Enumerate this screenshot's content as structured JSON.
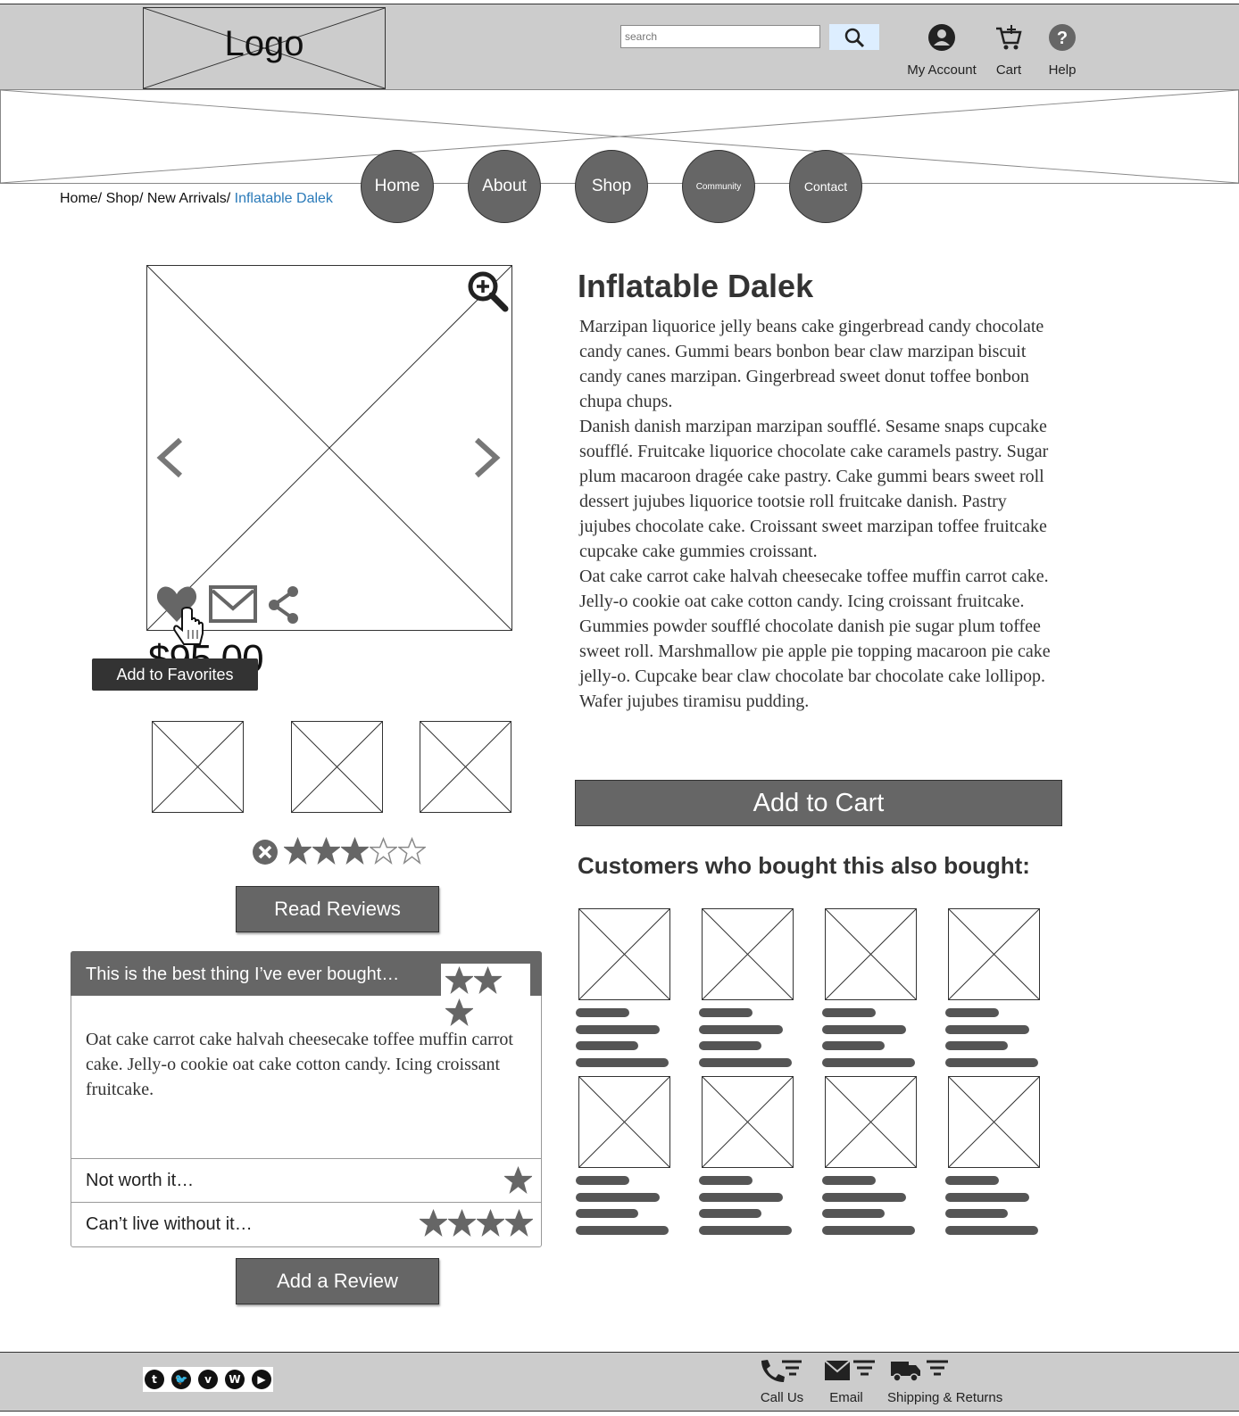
{
  "header": {
    "logo": "Logo",
    "search_placeholder": "search",
    "my_account": "My Account",
    "cart": "Cart",
    "help": "Help"
  },
  "nav": {
    "home": "Home",
    "about": "About",
    "shop": "Shop",
    "community": "Community",
    "contact": "Contact"
  },
  "breadcrumb": {
    "path": "Home/ Shop/ New Arrivals/ ",
    "current": "Inflatable Dalek"
  },
  "product": {
    "title": "Inflatable Dalek",
    "price": "$95.00",
    "tooltip": "Add to Favorites",
    "description": [
      "Marzipan liquorice jelly beans cake gingerbread candy chocolate candy canes. Gummi bears bonbon bear claw marzipan biscuit candy canes marzipan. Gingerbread sweet donut toffee bonbon chupa chups.",
      "Danish danish marzipan marzipan soufflé. Sesame snaps cupcake soufflé. Fruitcake liquorice chocolate cake caramels pastry. Sugar plum macaroon dragée cake pastry. Cake gummi bears sweet roll dessert jujubes liquorice tootsie roll fruitcake danish. Pastry jujubes chocolate cake. Croissant sweet marzipan toffee fruitcake cupcake cake gummies croissant.",
      "Oat cake carrot cake halvah cheesecake toffee muffin carrot cake. Jelly-o cookie oat cake cotton candy. Icing croissant fruitcake.",
      "Gummies powder soufflé chocolate danish pie sugar plum toffee sweet roll. Marshmallow pie apple pie topping macaroon pie cake jelly-o. Cupcake bear claw chocolate bar chocolate cake lollipop. Wafer jujubes tiramisu pudding."
    ],
    "add_to_cart": "Add to Cart",
    "rating": 3,
    "rating_max": 5
  },
  "reviews": {
    "read_reviews": "Read Reviews",
    "add_review": "Add a Review",
    "items": [
      {
        "title": "This is the best thing I’ve ever bought…",
        "stars": 3,
        "body": "Oat cake carrot cake halvah cheesecake toffee muffin carrot cake. Jelly-o cookie oat cake cotton candy. Icing croissant fruitcake."
      },
      {
        "title": "Not worth it…",
        "stars": 1
      },
      {
        "title": "Can’t live without it…",
        "stars": 4
      }
    ]
  },
  "also_bought": {
    "heading": "Customers who bought this also bought:"
  },
  "footer": {
    "call_us": "Call Us",
    "email": "Email",
    "shipping": "Shipping & Returns",
    "social": [
      "tumblr-icon",
      "twitter-icon",
      "vimeo-icon",
      "wordpress-icon",
      "youtube-icon"
    ]
  },
  "colors": {
    "header_bg": "#cccccc",
    "button_gray": "#666666",
    "link_blue": "#2a7ab9",
    "search_button": "#ddeeff"
  }
}
